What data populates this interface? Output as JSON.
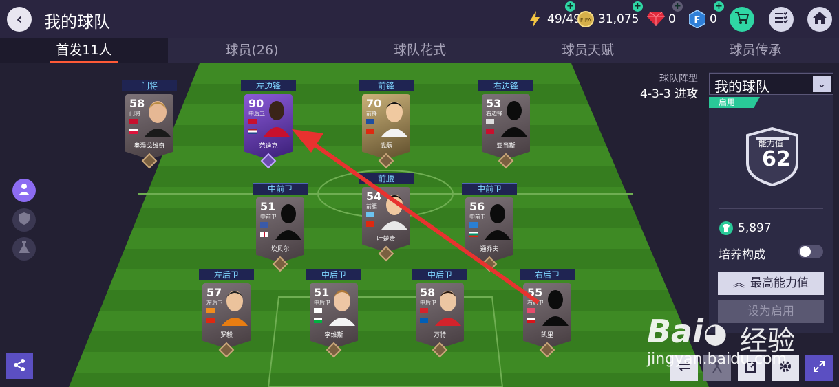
{
  "header": {
    "title": "我的球队",
    "stamina": "49/49",
    "coins": "31,075",
    "gems": "0",
    "fc_points": "0",
    "fifa_label": "FIFA"
  },
  "tabs": [
    {
      "label": "首发11人"
    },
    {
      "label": "球员(26)"
    },
    {
      "label": "球队花式"
    },
    {
      "label": "球员天赋"
    },
    {
      "label": "球员传承"
    }
  ],
  "formation": {
    "title": "球队阵型",
    "value": "4-3-3 进攻"
  },
  "squad": {
    "name": "我的球队",
    "status": "启用",
    "ability_label": "能力值",
    "ability_value": "62",
    "training_coins": "5,897",
    "training_label": "培养构成",
    "max_button": "最高能力值",
    "set_active_button": "设为启用"
  },
  "players": [
    {
      "pos": "门将",
      "pos_sm": "门将",
      "rating": "58",
      "name": "奥泽戈维奇",
      "tier": "bronze",
      "silhouette": false
    },
    {
      "pos": "左边锋",
      "pos_sm": "中后卫",
      "rating": "90",
      "name": "范迪克",
      "tier": "purple",
      "silhouette": false
    },
    {
      "pos": "前锋",
      "pos_sm": "前锋",
      "rating": "70",
      "name": "武磊",
      "tier": "gold",
      "silhouette": false
    },
    {
      "pos": "右边锋",
      "pos_sm": "右边锋",
      "rating": "53",
      "name": "亚当斯",
      "tier": "bronze",
      "silhouette": true
    },
    {
      "pos": "中前卫",
      "pos_sm": "中前卫",
      "rating": "51",
      "name": "坎贝尔",
      "tier": "bronze",
      "silhouette": true
    },
    {
      "pos": "前腰",
      "pos_sm": "前腰",
      "rating": "54",
      "name": "叶楚贵",
      "tier": "bronze",
      "silhouette": false
    },
    {
      "pos": "中前卫",
      "pos_sm": "中前卫",
      "rating": "56",
      "name": "通乔夫",
      "tier": "bronze",
      "silhouette": true
    },
    {
      "pos": "左后卫",
      "pos_sm": "左后卫",
      "rating": "57",
      "name": "罗毅",
      "tier": "bronze",
      "silhouette": false
    },
    {
      "pos": "中后卫",
      "pos_sm": "中后卫",
      "rating": "51",
      "name": "李维斯",
      "tier": "bronze",
      "silhouette": false
    },
    {
      "pos": "中后卫",
      "pos_sm": "中后卫",
      "rating": "58",
      "name": "万特",
      "tier": "bronze",
      "silhouette": false
    },
    {
      "pos": "右后卫",
      "pos_sm": "右后卫",
      "rating": "55",
      "name": "凯里",
      "tier": "bronze",
      "silhouette": true
    }
  ],
  "watermark": {
    "brand": "Bai",
    "suffix": "经验",
    "url": "jingyan.baidu.com"
  },
  "colors": {
    "accent": "#ff5a37",
    "active": "#29c998",
    "pitch": "#3f8a22"
  }
}
